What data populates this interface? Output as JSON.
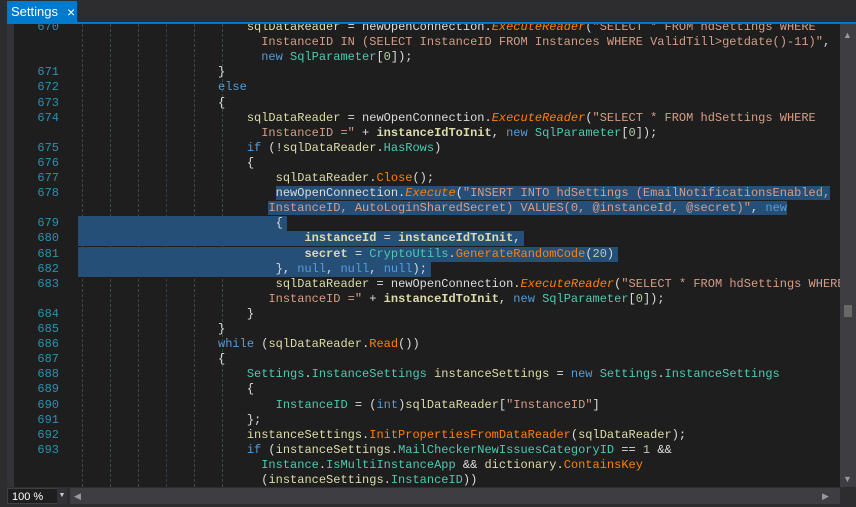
{
  "tab": {
    "title": "Settings",
    "close_icon": "×"
  },
  "zoom": {
    "value": "100 %"
  },
  "colors": {
    "accent": "#007acc",
    "selection": "#264f78",
    "line_number": "#2b91af"
  },
  "rows": [
    {
      "n": "670",
      "t": [
        [
          "p",
          "                        "
        ],
        [
          "v",
          "sqlDataReader"
        ],
        [
          "p",
          " = newOpenConnection."
        ],
        [
          "mi",
          "ExecuteReader"
        ],
        [
          "p",
          "("
        ],
        [
          "s",
          "\"SELECT * FROM hdSettings WHERE"
        ]
      ]
    },
    {
      "n": "",
      "t": [
        [
          "p",
          "                          "
        ],
        [
          "s",
          "InstanceID IN (SELECT InstanceID FROM Instances WHERE ValidTill>getdate()-11)\""
        ],
        [
          "p",
          ","
        ]
      ]
    },
    {
      "n": "",
      "t": [
        [
          "p",
          "                          "
        ],
        [
          "k",
          "new "
        ],
        [
          "t",
          "SqlParameter"
        ],
        [
          "p",
          "["
        ],
        [
          "n",
          "0"
        ],
        [
          "p",
          "]);"
        ]
      ]
    },
    {
      "n": "671",
      "t": [
        [
          "p",
          "                    }"
        ]
      ]
    },
    {
      "n": "672",
      "t": [
        [
          "p",
          "                    "
        ],
        [
          "k",
          "else"
        ]
      ]
    },
    {
      "n": "673",
      "t": [
        [
          "p",
          "                    {"
        ]
      ]
    },
    {
      "n": "674",
      "t": [
        [
          "p",
          "                        "
        ],
        [
          "v",
          "sqlDataReader"
        ],
        [
          "p",
          " = newOpenConnection."
        ],
        [
          "mi",
          "ExecuteReader"
        ],
        [
          "p",
          "("
        ],
        [
          "s",
          "\"SELECT * FROM hdSettings WHERE"
        ]
      ]
    },
    {
      "n": "",
      "t": [
        [
          "p",
          "                          "
        ],
        [
          "s",
          "InstanceID =\""
        ],
        [
          "p",
          " + "
        ],
        [
          "b",
          "instanceIdToInit"
        ],
        [
          "p",
          ", "
        ],
        [
          "k",
          "new "
        ],
        [
          "t",
          "SqlParameter"
        ],
        [
          "p",
          "["
        ],
        [
          "n",
          "0"
        ],
        [
          "p",
          "]);"
        ]
      ]
    },
    {
      "n": "675",
      "t": [
        [
          "p",
          "                        "
        ],
        [
          "k",
          "if"
        ],
        [
          "p",
          " (!"
        ],
        [
          "v",
          "sqlDataReader"
        ],
        [
          "p",
          "."
        ],
        [
          "t",
          "HasRows"
        ],
        [
          "p",
          ")"
        ]
      ]
    },
    {
      "n": "676",
      "t": [
        [
          "p",
          "                        {"
        ]
      ]
    },
    {
      "n": "677",
      "t": [
        [
          "p",
          "                            "
        ],
        [
          "v",
          "sqlDataReader"
        ],
        [
          "p",
          "."
        ],
        [
          "m",
          "Close"
        ],
        [
          "p",
          "();"
        ]
      ]
    },
    {
      "n": "678",
      "t": [
        [
          "p",
          "                            "
        ],
        [
          "p sel",
          "newOpenConnection."
        ],
        [
          "mi sel",
          "Execute"
        ],
        [
          "p sel",
          "("
        ],
        [
          "s sel",
          "\"INSERT INTO hdSettings (EmailNotificationsEnabled,"
        ]
      ]
    },
    {
      "n": "",
      "t": [
        [
          "p",
          "                           "
        ],
        [
          "s sel",
          "InstanceID, AutoLoginSharedSecret) VALUES(0, @instanceId, @secret)\""
        ],
        [
          "p sel",
          ", "
        ],
        [
          "k sel",
          "new"
        ]
      ]
    },
    {
      "n": "679",
      "full": true,
      "t": [
        [
          "p",
          "                            {"
        ]
      ]
    },
    {
      "n": "680",
      "full": true,
      "t": [
        [
          "p",
          "                                "
        ],
        [
          "b",
          "instanceId"
        ],
        [
          "p",
          " = "
        ],
        [
          "b",
          "instanceIdToInit"
        ],
        [
          "p",
          ","
        ]
      ]
    },
    {
      "n": "681",
      "full": true,
      "t": [
        [
          "p",
          "                                "
        ],
        [
          "b",
          "secret"
        ],
        [
          "p",
          " = "
        ],
        [
          "t",
          "CryptoUtils"
        ],
        [
          "p",
          "."
        ],
        [
          "m",
          "GenerateRandomCode"
        ],
        [
          "p",
          "("
        ],
        [
          "n",
          "20"
        ],
        [
          "p",
          ")"
        ]
      ]
    },
    {
      "n": "682",
      "full": true,
      "t": [
        [
          "p",
          "                            }, "
        ],
        [
          "k",
          "null"
        ],
        [
          "p",
          ", "
        ],
        [
          "k",
          "null"
        ],
        [
          "p",
          ", "
        ],
        [
          "k",
          "null"
        ],
        [
          "p",
          ");"
        ]
      ]
    },
    {
      "n": "683",
      "t": [
        [
          "p",
          "                            "
        ],
        [
          "v",
          "sqlDataReader"
        ],
        [
          "p",
          " = newOpenConnection."
        ],
        [
          "mi",
          "ExecuteReader"
        ],
        [
          "p",
          "("
        ],
        [
          "s",
          "\"SELECT * FROM hdSettings WHERE"
        ]
      ]
    },
    {
      "n": "",
      "t": [
        [
          "p",
          "                           "
        ],
        [
          "s",
          "InstanceID =\""
        ],
        [
          "p",
          " + "
        ],
        [
          "b",
          "instanceIdToInit"
        ],
        [
          "p",
          ", "
        ],
        [
          "k",
          "new "
        ],
        [
          "t",
          "SqlParameter"
        ],
        [
          "p",
          "["
        ],
        [
          "n",
          "0"
        ],
        [
          "p",
          "]);"
        ]
      ]
    },
    {
      "n": "684",
      "t": [
        [
          "p",
          "                        }"
        ]
      ]
    },
    {
      "n": "685",
      "t": [
        [
          "p",
          "                    }"
        ]
      ]
    },
    {
      "n": "686",
      "t": [
        [
          "p",
          "                    "
        ],
        [
          "k",
          "while"
        ],
        [
          "p",
          " ("
        ],
        [
          "v",
          "sqlDataReader"
        ],
        [
          "p",
          "."
        ],
        [
          "m",
          "Read"
        ],
        [
          "p",
          "())"
        ]
      ]
    },
    {
      "n": "687",
      "t": [
        [
          "p",
          "                    {"
        ]
      ]
    },
    {
      "n": "688",
      "t": [
        [
          "p",
          "                        "
        ],
        [
          "t",
          "Settings"
        ],
        [
          "p",
          "."
        ],
        [
          "t",
          "InstanceSettings "
        ],
        [
          "v",
          "instanceSettings"
        ],
        [
          "p",
          " = "
        ],
        [
          "k",
          "new "
        ],
        [
          "t",
          "Settings"
        ],
        [
          "p",
          "."
        ],
        [
          "t",
          "InstanceSettings"
        ]
      ]
    },
    {
      "n": "689",
      "t": [
        [
          "p",
          "                        {"
        ]
      ]
    },
    {
      "n": "690",
      "t": [
        [
          "p",
          "                            "
        ],
        [
          "t",
          "InstanceID"
        ],
        [
          "p",
          " = ("
        ],
        [
          "k",
          "int"
        ],
        [
          "p",
          ")"
        ],
        [
          "v",
          "sqlDataReader"
        ],
        [
          "p",
          "["
        ],
        [
          "s",
          "\"InstanceID\""
        ],
        [
          "p",
          "]"
        ]
      ]
    },
    {
      "n": "691",
      "t": [
        [
          "p",
          "                        };"
        ]
      ]
    },
    {
      "n": "692",
      "t": [
        [
          "p",
          "                        "
        ],
        [
          "v",
          "instanceSettings"
        ],
        [
          "p",
          "."
        ],
        [
          "m",
          "InitPropertiesFromDataReader"
        ],
        [
          "p",
          "("
        ],
        [
          "v",
          "sqlDataReader"
        ],
        [
          "p",
          ");"
        ]
      ]
    },
    {
      "n": "693",
      "t": [
        [
          "p",
          "                        "
        ],
        [
          "k",
          "if"
        ],
        [
          "p",
          " ("
        ],
        [
          "v",
          "instanceSettings"
        ],
        [
          "p",
          "."
        ],
        [
          "t",
          "MailCheckerNewIssuesCategoryID"
        ],
        [
          "p",
          " == "
        ],
        [
          "n",
          "1"
        ],
        [
          "p",
          " &&"
        ]
      ]
    },
    {
      "n": "",
      "t": [
        [
          "p",
          "                          "
        ],
        [
          "t",
          "Instance"
        ],
        [
          "p",
          "."
        ],
        [
          "t",
          "IsMultiInstanceApp"
        ],
        [
          "p",
          " && "
        ],
        [
          "v",
          "dictionary"
        ],
        [
          "p",
          "."
        ],
        [
          "m",
          "ContainsKey"
        ]
      ]
    },
    {
      "n": "",
      "t": [
        [
          "p",
          "                          ("
        ],
        [
          "v",
          "instanceSettings"
        ],
        [
          "p",
          "."
        ],
        [
          "t",
          "InstanceID"
        ],
        [
          "p",
          "))"
        ]
      ]
    }
  ]
}
